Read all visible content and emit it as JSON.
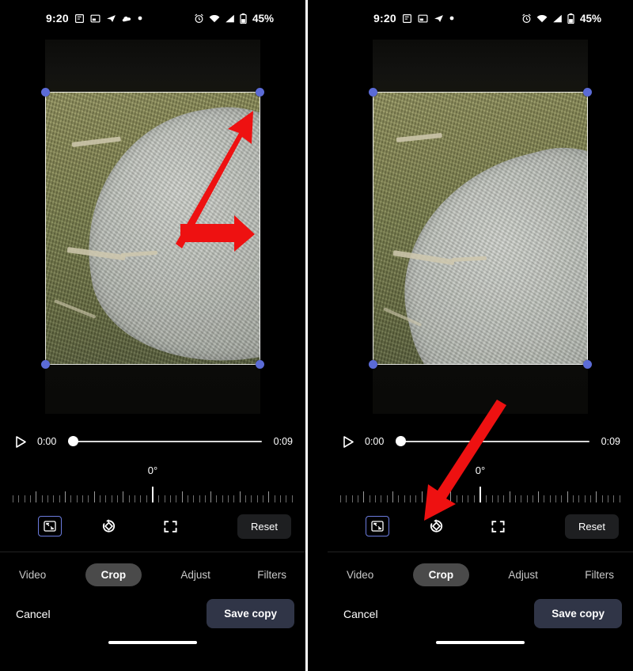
{
  "status_bar": {
    "time": "9:20",
    "left_icons": [
      "note-icon",
      "screenshot-icon",
      "telegram-icon",
      "cloud-icon",
      "dot-icon"
    ],
    "right_icons": [
      "alarm-icon",
      "wifi-icon",
      "signal-icon",
      "battery-icon"
    ],
    "battery_percent": "45%"
  },
  "player": {
    "play_icon": "play-icon",
    "current_time": "0:00",
    "duration": "0:09",
    "progress_percent": 0
  },
  "rotation": {
    "angle_label": "0°",
    "value": 0
  },
  "tools": [
    {
      "name": "aspect-ratio-icon",
      "label": "Aspect ratio",
      "selected": true
    },
    {
      "name": "rotate-icon",
      "label": "Rotate",
      "selected": false
    },
    {
      "name": "perspective-icon",
      "label": "Auto perspective",
      "selected": false
    }
  ],
  "reset_label": "Reset",
  "tabs": [
    {
      "label": "Video",
      "active": false
    },
    {
      "label": "Crop",
      "active": true
    },
    {
      "label": "Adjust",
      "active": false
    },
    {
      "label": "Filters",
      "active": false
    }
  ],
  "footer": {
    "cancel_label": "Cancel",
    "save_label": "Save copy"
  },
  "colors": {
    "accent": "#5b6bd6",
    "annotation": "#ee1111",
    "save_button": "#303547",
    "active_tab": "#4a4a4a",
    "reset_button": "#1e1f21",
    "background": "#000000"
  },
  "annotations": [
    {
      "name": "arrow-to-crop-corner",
      "panel": "left",
      "direction": "up-right"
    },
    {
      "name": "arrow-to-crop-edge",
      "panel": "left",
      "direction": "right"
    },
    {
      "name": "arrow-to-aspect-ratio-tool",
      "panel": "right",
      "direction": "down-left"
    }
  ],
  "panels": [
    {
      "name": "before-crop-adjust"
    },
    {
      "name": "after-crop-adjust"
    }
  ]
}
